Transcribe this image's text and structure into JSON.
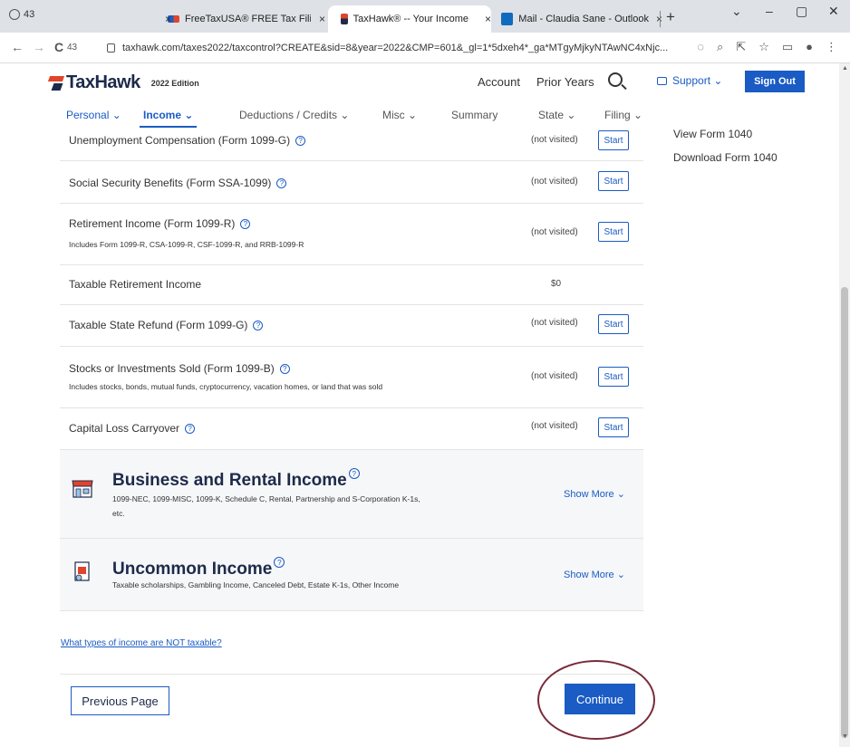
{
  "browser": {
    "tab_count": "43",
    "tabs": [
      {
        "label": "FreeTaxUSA® FREE Tax Filing",
        "close": "×"
      },
      {
        "label": "TaxHawk® -- Your Income",
        "close": "×"
      },
      {
        "label": "Mail - Claudia Sane - Outlook",
        "close": "×"
      }
    ],
    "new_tab": "+",
    "window_controls": [
      "⌄",
      "–",
      "▢",
      "✕"
    ],
    "nav": {
      "back": "←",
      "forward": "→",
      "reload": "C",
      "badge": "43"
    },
    "url": "taxhawk.com/taxes2022/taxcontrol?CREATE&sid=8&year=2022&CMP=601&_gl=1*5dxeh4*_ga*MTgyMjkyNTAwNC4xNjc..."
  },
  "header": {
    "logo": "TaxHawk",
    "edition": "2022 Edition",
    "account": "Account",
    "prior_years": "Prior Years",
    "support": "Support ⌄",
    "sign_out": "Sign Out"
  },
  "nav": {
    "personal": "Personal ⌄",
    "income": "Income ⌄",
    "deductions": "Deductions / Credits ⌄",
    "misc": "Misc ⌄",
    "summary": "Summary",
    "state": "State ⌄",
    "filing": "Filing ⌄"
  },
  "sidebar": {
    "view_form": "View Form 1040",
    "download_form": "Download Form 1040"
  },
  "rows": [
    {
      "title": "Unemployment Compensation (Form 1099-G)",
      "status": "(not visited)",
      "button": "Start"
    },
    {
      "title": "Social Security Benefits (Form SSA-1099)",
      "status": "(not visited)",
      "button": "Start"
    },
    {
      "title": "Retirement Income (Form 1099-R)",
      "desc": "Includes Form 1099-R, CSA-1099-R, CSF-1099-R, and RRB-1099-R",
      "status": "(not visited)",
      "button": "Start"
    },
    {
      "title": "Taxable Retirement Income",
      "status": "$0"
    },
    {
      "title": "Taxable State Refund (Form 1099-G)",
      "status": "(not visited)",
      "button": "Start"
    },
    {
      "title": "Stocks or Investments Sold (Form 1099-B)",
      "desc": "Includes stocks, bonds, mutual funds, cryptocurrency, vacation homes, or land that was sold",
      "status": "(not visited)",
      "button": "Start"
    },
    {
      "title": "Capital Loss Carryover",
      "status": "(not visited)",
      "button": "Start"
    }
  ],
  "sections": [
    {
      "title": "Business and Rental Income",
      "desc": "1099-NEC, 1099-MISC, 1099-K, Schedule C, Rental, Partnership and S-Corporation K-1s, etc.",
      "more": "Show More ⌄"
    },
    {
      "title": "Uncommon Income",
      "desc": "Taxable scholarships, Gambling Income, Canceled Debt, Estate K-1s, Other Income",
      "more": "Show More ⌄"
    }
  ],
  "help_link": "What types of income are NOT taxable?",
  "footer": {
    "previous": "Previous Page",
    "continue": "Continue"
  },
  "qm": "?",
  "colors": {
    "brand_blue": "#1a5bc4",
    "logo_red": "#e0442b",
    "logo_navy": "#1d2a4a",
    "annotation_circle": "#7a2a3a"
  }
}
